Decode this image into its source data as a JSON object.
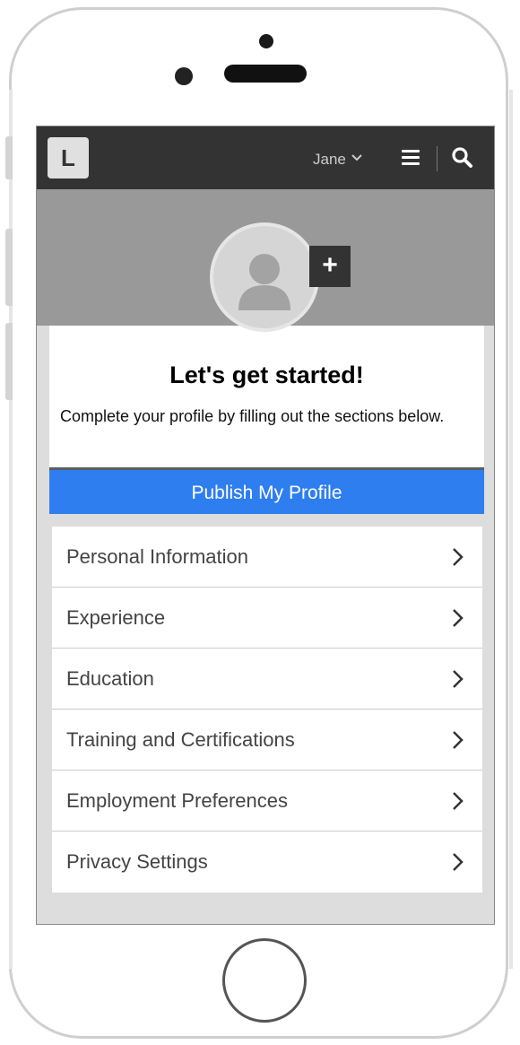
{
  "header": {
    "logo": "L",
    "user_name": "Jane",
    "icons": {
      "user_menu": "chevron-down-icon",
      "menu": "hamburger-menu-icon",
      "search": "search-icon"
    }
  },
  "profile": {
    "avatar_icon": "user-avatar-icon",
    "add_photo_label": "+",
    "title": "Let's get started!",
    "subtitle": "Complete your profile by filling out the sections below."
  },
  "publish_button": {
    "label": "Publish My Profile",
    "color": "#2e7ef0"
  },
  "sections": [
    {
      "label": "Personal Information"
    },
    {
      "label": "Experience"
    },
    {
      "label": "Education"
    },
    {
      "label": "Training and Certifications"
    },
    {
      "label": "Employment Preferences"
    },
    {
      "label": "Privacy Settings"
    }
  ],
  "colors": {
    "topbar": "#333333",
    "banner": "#999999",
    "screen_bg": "#dddddd"
  }
}
